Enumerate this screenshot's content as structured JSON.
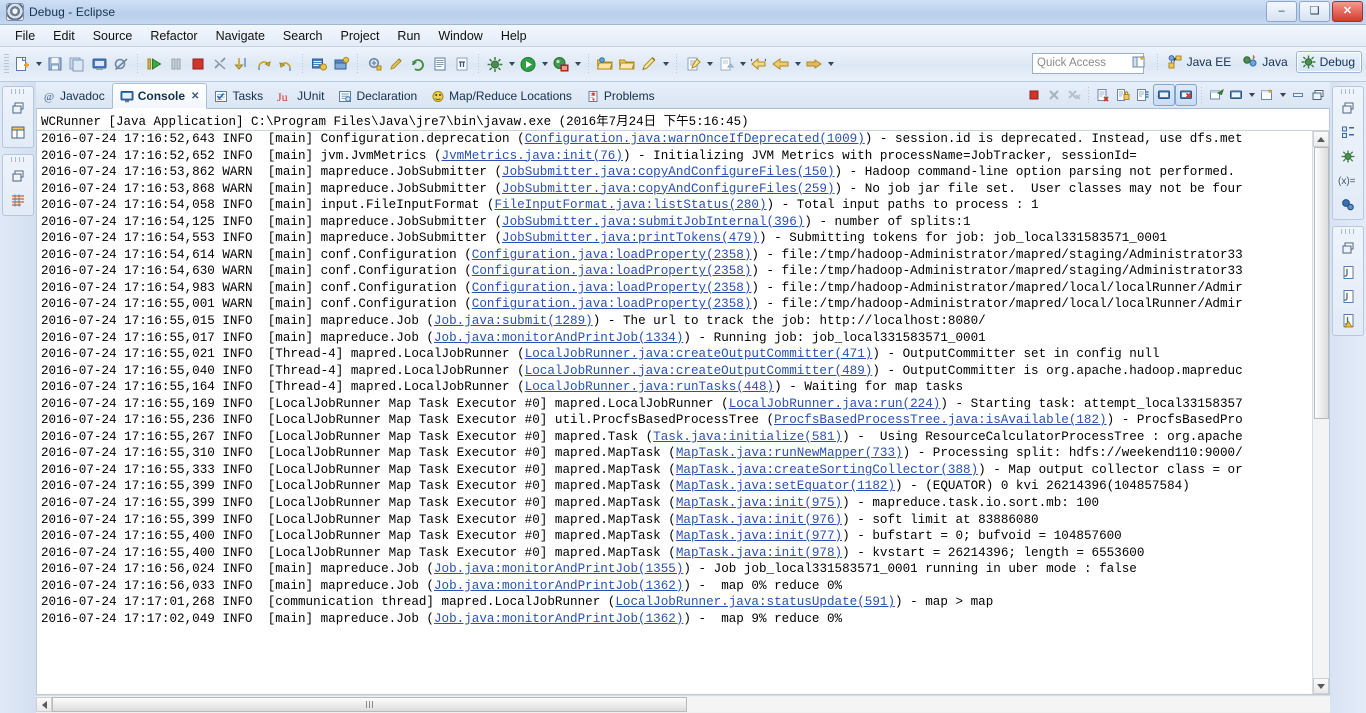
{
  "window": {
    "title": "Debug - Eclipse",
    "minimize_label": "–",
    "maximize_label": "❑",
    "close_label": "✕"
  },
  "menu": {
    "items": [
      {
        "label": "File"
      },
      {
        "label": "Edit"
      },
      {
        "label": "Source"
      },
      {
        "label": "Refactor"
      },
      {
        "label": "Navigate"
      },
      {
        "label": "Search"
      },
      {
        "label": "Project"
      },
      {
        "label": "Run"
      },
      {
        "label": "Window"
      },
      {
        "label": "Help"
      }
    ]
  },
  "toolbar": {
    "quick_access_placeholder": "Quick Access",
    "perspectives": [
      {
        "label": "Java EE",
        "active": false
      },
      {
        "label": "Java",
        "active": false
      },
      {
        "label": "Debug",
        "active": true
      }
    ]
  },
  "view_tabs": [
    {
      "label": "Javadoc",
      "icon": "javadoc-icon",
      "selected": false
    },
    {
      "label": "Console",
      "icon": "console-icon",
      "selected": true,
      "close": "✕"
    },
    {
      "label": "Tasks",
      "icon": "tasks-icon",
      "selected": false
    },
    {
      "label": "JUnit",
      "icon": "junit-icon",
      "selected": false
    },
    {
      "label": "Declaration",
      "icon": "declaration-icon",
      "selected": false
    },
    {
      "label": "Map/Reduce Locations",
      "icon": "mapreduce-icon",
      "selected": false
    },
    {
      "label": "Problems",
      "icon": "problems-icon",
      "selected": false
    }
  ],
  "console": {
    "header": "WCRunner [Java Application] C:\\Program Files\\Java\\jre7\\bin\\javaw.exe (2016年7月24日 下午5:16:45)",
    "lines": [
      [
        {
          "t": "2016-07-24 17:16:52,643 INFO  [main] Configuration.deprecation ("
        },
        {
          "t": "Configuration.java:warnOnceIfDeprecated(1009)",
          "link": true
        },
        {
          "t": ") - session.id is deprecated. Instead, use dfs.met"
        }
      ],
      [
        {
          "t": "2016-07-24 17:16:52,652 INFO  [main] jvm.JvmMetrics ("
        },
        {
          "t": "JvmMetrics.java:init(76)",
          "link": true
        },
        {
          "t": ") - Initializing JVM Metrics with processName=JobTracker, sessionId="
        }
      ],
      [
        {
          "t": "2016-07-24 17:16:53,862 WARN  [main] mapreduce.JobSubmitter ("
        },
        {
          "t": "JobSubmitter.java:copyAndConfigureFiles(150)",
          "link": true
        },
        {
          "t": ") - Hadoop command-line option parsing not performed."
        }
      ],
      [
        {
          "t": "2016-07-24 17:16:53,868 WARN  [main] mapreduce.JobSubmitter ("
        },
        {
          "t": "JobSubmitter.java:copyAndConfigureFiles(259)",
          "link": true
        },
        {
          "t": ") - No job jar file set.  User classes may not be four"
        }
      ],
      [
        {
          "t": "2016-07-24 17:16:54,058 INFO  [main] input.FileInputFormat ("
        },
        {
          "t": "FileInputFormat.java:listStatus(280)",
          "link": true
        },
        {
          "t": ") - Total input paths to process : 1"
        }
      ],
      [
        {
          "t": "2016-07-24 17:16:54,125 INFO  [main] mapreduce.JobSubmitter ("
        },
        {
          "t": "JobSubmitter.java:submitJobInternal(396)",
          "link": true
        },
        {
          "t": ") - number of splits:1"
        }
      ],
      [
        {
          "t": "2016-07-24 17:16:54,553 INFO  [main] mapreduce.JobSubmitter ("
        },
        {
          "t": "JobSubmitter.java:printTokens(479)",
          "link": true
        },
        {
          "t": ") - Submitting tokens for job: job_local331583571_0001"
        }
      ],
      [
        {
          "t": "2016-07-24 17:16:54,614 WARN  [main] conf.Configuration ("
        },
        {
          "t": "Configuration.java:loadProperty(2358)",
          "link": true
        },
        {
          "t": ") - file:/tmp/hadoop-Administrator/mapred/staging/Administrator33"
        }
      ],
      [
        {
          "t": "2016-07-24 17:16:54,630 WARN  [main] conf.Configuration ("
        },
        {
          "t": "Configuration.java:loadProperty(2358)",
          "link": true
        },
        {
          "t": ") - file:/tmp/hadoop-Administrator/mapred/staging/Administrator33"
        }
      ],
      [
        {
          "t": "2016-07-24 17:16:54,983 WARN  [main] conf.Configuration ("
        },
        {
          "t": "Configuration.java:loadProperty(2358)",
          "link": true
        },
        {
          "t": ") - file:/tmp/hadoop-Administrator/mapred/local/localRunner/Admir"
        }
      ],
      [
        {
          "t": "2016-07-24 17:16:55,001 WARN  [main] conf.Configuration ("
        },
        {
          "t": "Configuration.java:loadProperty(2358)",
          "link": true
        },
        {
          "t": ") - file:/tmp/hadoop-Administrator/mapred/local/localRunner/Admir"
        }
      ],
      [
        {
          "t": "2016-07-24 17:16:55,015 INFO  [main] mapreduce.Job ("
        },
        {
          "t": "Job.java:submit(1289)",
          "link": true
        },
        {
          "t": ") - The url to track the job: http://localhost:8080/"
        }
      ],
      [
        {
          "t": "2016-07-24 17:16:55,017 INFO  [main] mapreduce.Job ("
        },
        {
          "t": "Job.java:monitorAndPrintJob(1334)",
          "link": true
        },
        {
          "t": ") - Running job: job_local331583571_0001"
        }
      ],
      [
        {
          "t": "2016-07-24 17:16:55,021 INFO  [Thread-4] mapred.LocalJobRunner ("
        },
        {
          "t": "LocalJobRunner.java:createOutputCommitter(471)",
          "link": true
        },
        {
          "t": ") - OutputCommitter set in config null"
        }
      ],
      [
        {
          "t": "2016-07-24 17:16:55,040 INFO  [Thread-4] mapred.LocalJobRunner ("
        },
        {
          "t": "LocalJobRunner.java:createOutputCommitter(489)",
          "link": true
        },
        {
          "t": ") - OutputCommitter is org.apache.hadoop.mapreduc"
        }
      ],
      [
        {
          "t": "2016-07-24 17:16:55,164 INFO  [Thread-4] mapred.LocalJobRunner ("
        },
        {
          "t": "LocalJobRunner.java:runTasks(448)",
          "link": true
        },
        {
          "t": ") - Waiting for map tasks"
        }
      ],
      [
        {
          "t": "2016-07-24 17:16:55,169 INFO  [LocalJobRunner Map Task Executor #0] mapred.LocalJobRunner ("
        },
        {
          "t": "LocalJobRunner.java:run(224)",
          "link": true
        },
        {
          "t": ") - Starting task: attempt_local33158357"
        }
      ],
      [
        {
          "t": "2016-07-24 17:16:55,236 INFO  [LocalJobRunner Map Task Executor #0] util.ProcfsBasedProcessTree ("
        },
        {
          "t": "ProcfsBasedProcessTree.java:isAvailable(182)",
          "link": true
        },
        {
          "t": ") - ProcfsBasedPro"
        }
      ],
      [
        {
          "t": "2016-07-24 17:16:55,267 INFO  [LocalJobRunner Map Task Executor #0] mapred.Task ("
        },
        {
          "t": "Task.java:initialize(581)",
          "link": true
        },
        {
          "t": ") -  Using ResourceCalculatorProcessTree : org.apache"
        }
      ],
      [
        {
          "t": "2016-07-24 17:16:55,310 INFO  [LocalJobRunner Map Task Executor #0] mapred.MapTask ("
        },
        {
          "t": "MapTask.java:runNewMapper(733)",
          "link": true
        },
        {
          "t": ") - Processing split: hdfs://weekend110:9000/"
        }
      ],
      [
        {
          "t": "2016-07-24 17:16:55,333 INFO  [LocalJobRunner Map Task Executor #0] mapred.MapTask ("
        },
        {
          "t": "MapTask.java:createSortingCollector(388)",
          "link": true
        },
        {
          "t": ") - Map output collector class = or"
        }
      ],
      [
        {
          "t": "2016-07-24 17:16:55,399 INFO  [LocalJobRunner Map Task Executor #0] mapred.MapTask ("
        },
        {
          "t": "MapTask.java:setEquator(1182)",
          "link": true
        },
        {
          "t": ") - (EQUATOR) 0 kvi 26214396(104857584)"
        }
      ],
      [
        {
          "t": "2016-07-24 17:16:55,399 INFO  [LocalJobRunner Map Task Executor #0] mapred.MapTask ("
        },
        {
          "t": "MapTask.java:init(975)",
          "link": true
        },
        {
          "t": ") - mapreduce.task.io.sort.mb: 100"
        }
      ],
      [
        {
          "t": "2016-07-24 17:16:55,399 INFO  [LocalJobRunner Map Task Executor #0] mapred.MapTask ("
        },
        {
          "t": "MapTask.java:init(976)",
          "link": true
        },
        {
          "t": ") - soft limit at 83886080"
        }
      ],
      [
        {
          "t": "2016-07-24 17:16:55,400 INFO  [LocalJobRunner Map Task Executor #0] mapred.MapTask ("
        },
        {
          "t": "MapTask.java:init(977)",
          "link": true
        },
        {
          "t": ") - bufstart = 0; bufvoid = 104857600"
        }
      ],
      [
        {
          "t": "2016-07-24 17:16:55,400 INFO  [LocalJobRunner Map Task Executor #0] mapred.MapTask ("
        },
        {
          "t": "MapTask.java:init(978)",
          "link": true
        },
        {
          "t": ") - kvstart = 26214396; length = 6553600"
        }
      ],
      [
        {
          "t": "2016-07-24 17:16:56,024 INFO  [main] mapreduce.Job ("
        },
        {
          "t": "Job.java:monitorAndPrintJob(1355)",
          "link": true
        },
        {
          "t": ") - Job job_local331583571_0001 running in uber mode : false"
        }
      ],
      [
        {
          "t": "2016-07-24 17:16:56,033 INFO  [main] mapreduce.Job ("
        },
        {
          "t": "Job.java:monitorAndPrintJob(1362)",
          "link": true
        },
        {
          "t": ") -  map 0% reduce 0%"
        }
      ],
      [
        {
          "t": "2016-07-24 17:17:01,268 INFO  [communication thread] mapred.LocalJobRunner ("
        },
        {
          "t": "LocalJobRunner.java:statusUpdate(591)",
          "link": true
        },
        {
          "t": ") - map > map"
        }
      ],
      [
        {
          "t": "2016-07-24 17:17:02,049 INFO  [main] mapreduce.Job ("
        },
        {
          "t": "Job.java:monitorAndPrintJob(1362)",
          "link": true
        },
        {
          "t": ") -  map 9% reduce 0%"
        }
      ]
    ]
  },
  "colors": {
    "link": "#2b50b0",
    "accent": "#2b6cb0",
    "titlebar_text": "#15324f"
  }
}
